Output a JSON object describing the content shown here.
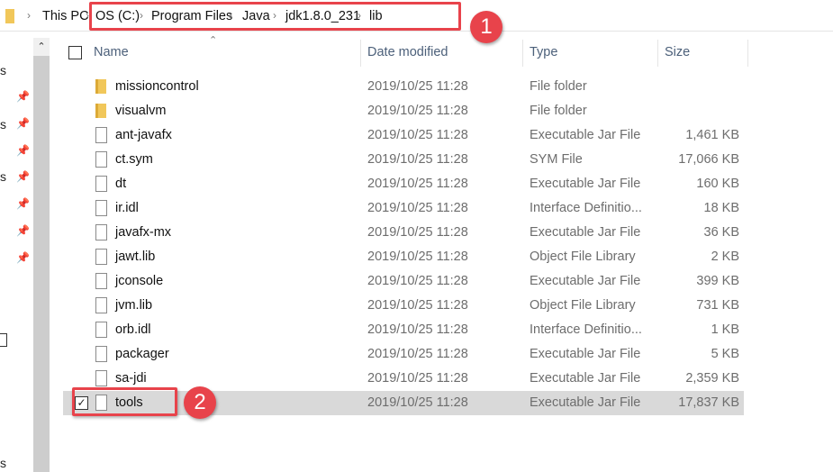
{
  "breadcrumb": [
    "This PC",
    "OS (C:)",
    "Program Files",
    "Java",
    "jdk1.8.0_231",
    "lib"
  ],
  "annotations": [
    "1",
    "2"
  ],
  "headers": {
    "name": "Name",
    "date": "Date modified",
    "type": "Type",
    "size": "Size"
  },
  "nav_fragments": [
    "s",
    "s",
    "s",
    "s"
  ],
  "files": [
    {
      "name": "missioncontrol",
      "date": "2019/10/25 11:28",
      "type": "File folder",
      "size": "",
      "kind": "folder"
    },
    {
      "name": "visualvm",
      "date": "2019/10/25 11:28",
      "type": "File folder",
      "size": "",
      "kind": "folder"
    },
    {
      "name": "ant-javafx",
      "date": "2019/10/25 11:28",
      "type": "Executable Jar File",
      "size": "1,461 KB",
      "kind": "file"
    },
    {
      "name": "ct.sym",
      "date": "2019/10/25 11:28",
      "type": "SYM File",
      "size": "17,066 KB",
      "kind": "file"
    },
    {
      "name": "dt",
      "date": "2019/10/25 11:28",
      "type": "Executable Jar File",
      "size": "160 KB",
      "kind": "file"
    },
    {
      "name": "ir.idl",
      "date": "2019/10/25 11:28",
      "type": "Interface Definitio...",
      "size": "18 KB",
      "kind": "file"
    },
    {
      "name": "javafx-mx",
      "date": "2019/10/25 11:28",
      "type": "Executable Jar File",
      "size": "36 KB",
      "kind": "file"
    },
    {
      "name": "jawt.lib",
      "date": "2019/10/25 11:28",
      "type": "Object File Library",
      "size": "2 KB",
      "kind": "file"
    },
    {
      "name": "jconsole",
      "date": "2019/10/25 11:28",
      "type": "Executable Jar File",
      "size": "399 KB",
      "kind": "file"
    },
    {
      "name": "jvm.lib",
      "date": "2019/10/25 11:28",
      "type": "Object File Library",
      "size": "731 KB",
      "kind": "file"
    },
    {
      "name": "orb.idl",
      "date": "2019/10/25 11:28",
      "type": "Interface Definitio...",
      "size": "1 KB",
      "kind": "file"
    },
    {
      "name": "packager",
      "date": "2019/10/25 11:28",
      "type": "Executable Jar File",
      "size": "5 KB",
      "kind": "file"
    },
    {
      "name": "sa-jdi",
      "date": "2019/10/25 11:28",
      "type": "Executable Jar File",
      "size": "2,359 KB",
      "kind": "file"
    },
    {
      "name": "tools",
      "date": "2019/10/25 11:28",
      "type": "Executable Jar File",
      "size": "17,837 KB",
      "kind": "file",
      "selected": true
    }
  ]
}
